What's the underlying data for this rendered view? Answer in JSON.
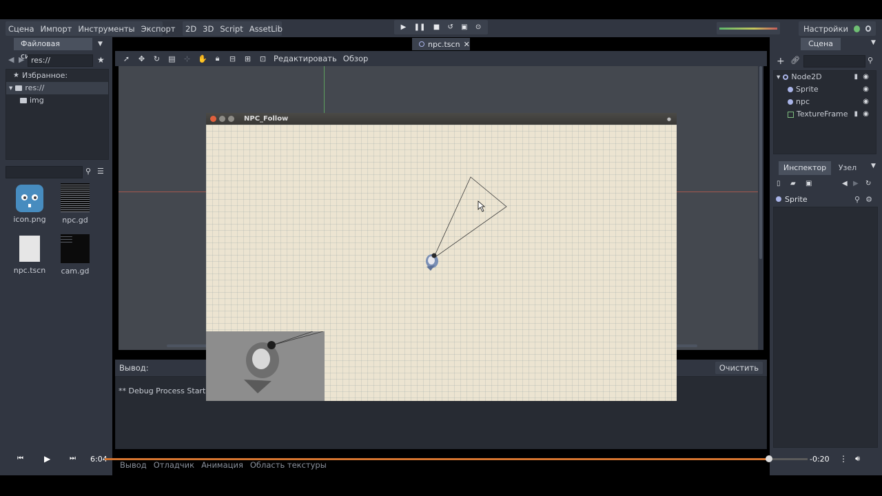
{
  "menu": {
    "items": [
      "Сцена",
      "Импорт",
      "Инструменты",
      "Экспорт"
    ],
    "workspace": [
      "2D",
      "3D",
      "Script",
      "AssetLib"
    ],
    "settings_label": "Настройки"
  },
  "play_controls": [
    "▶",
    "❚❚",
    "■",
    "↺",
    "▣",
    "⊙"
  ],
  "filesystem": {
    "tab_label": "Файловая система",
    "path": "res://",
    "tree": [
      {
        "label": "Избранное:"
      },
      {
        "label": "res://"
      },
      {
        "label": "img"
      }
    ],
    "files": [
      {
        "name": "icon.png"
      },
      {
        "name": "npc.gd"
      },
      {
        "name": "npc.tscn"
      },
      {
        "name": "cam.gd"
      }
    ]
  },
  "editor": {
    "scene_tab": "npc.tscn",
    "toolbar_edit": "Редактировать",
    "toolbar_view": "Обзор"
  },
  "output": {
    "title": "Вывод:",
    "clear_label": "Очистить",
    "log_line": "** Debug Process Started *"
  },
  "bottom_tabs": [
    "Вывод",
    "Отладчик",
    "Анимация",
    "Область текстуры"
  ],
  "scene": {
    "tab_label": "Сцена",
    "nodes": [
      {
        "name": "Node2D"
      },
      {
        "name": "Sprite"
      },
      {
        "name": "npc"
      },
      {
        "name": "TextureFrame"
      }
    ]
  },
  "inspector": {
    "tab_label": "Инспектор",
    "node_tab_label": "Узел",
    "object_name": "Sprite"
  },
  "game_window": {
    "title": "NPC_Follow"
  },
  "video": {
    "current_time": "6:04",
    "remaining_time": "-0:20",
    "progress_fraction": 0.945
  },
  "colors": {
    "editor_bg": "#313641",
    "accent_progress": "#d4742f",
    "paper": "#ece4d1"
  }
}
